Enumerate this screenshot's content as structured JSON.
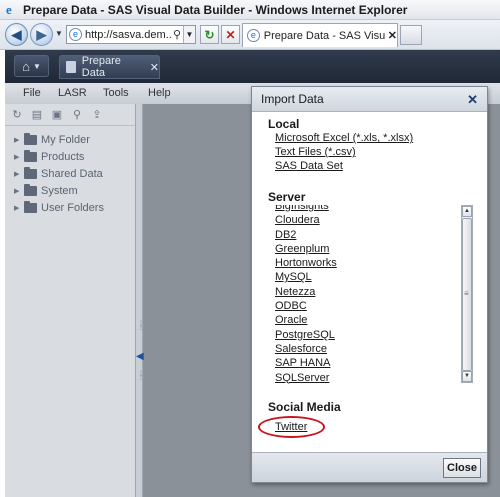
{
  "browser": {
    "title": "Prepare Data - SAS Visual Data Builder - Windows Internet Explorer",
    "address": "http://sasva.dem...",
    "tab_label": "Prepare Data - SAS Visual Da..."
  },
  "app": {
    "home_glyph": "⌂",
    "tab_label": "Prepare Data",
    "menu": [
      "File",
      "LASR",
      "Tools",
      "Help"
    ],
    "tree": [
      "My Folder",
      "Products",
      "Shared Data",
      "System",
      "User Folders"
    ]
  },
  "dialog": {
    "title": "Import Data",
    "local_title": "Local",
    "local_items": [
      "Microsoft Excel (*.xls, *.xlsx)",
      "Text Files (*.csv)",
      "SAS Data Set"
    ],
    "server_title": "Server",
    "server_items": [
      "BigInsights",
      "Cloudera",
      "DB2",
      "Greenplum",
      "Hortonworks",
      "MySQL",
      "Netezza",
      "ODBC",
      "Oracle",
      "PostgreSQL",
      "Salesforce",
      "SAP HANA",
      "SQLServer"
    ],
    "social_title": "Social Media",
    "social_items": [
      "Twitter"
    ],
    "close_label": "Close"
  },
  "colors": {
    "highlight_oval": "#c8161d",
    "app_header": "#2a3444"
  }
}
